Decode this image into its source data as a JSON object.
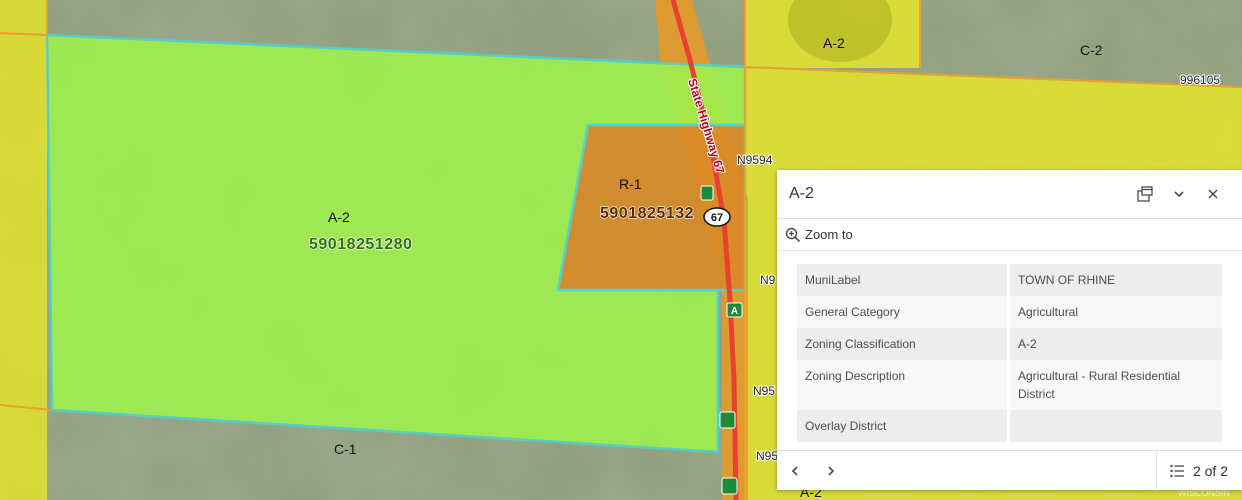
{
  "map": {
    "zone_labels": [
      "A-2",
      "C-2",
      "R-1",
      "A-2",
      "C-1",
      "A-2"
    ],
    "parcel_numbers": [
      "59018251280",
      "5901825132"
    ],
    "partial_parcel_number": "996105",
    "highway_name": "State Highway 67",
    "highway_shield": "67",
    "road_labels": [
      "N9594",
      "N9",
      "N95",
      "N95"
    ],
    "road_markers": [
      "A"
    ],
    "watermark": "WISCONSIN",
    "colors": {
      "agricultural": "#9ff04e",
      "residential": "#d98a28",
      "yellow_zone": "#e6e622",
      "outline": "#4fd3d0",
      "highway": "#e8412f"
    }
  },
  "popup": {
    "title": "A-2",
    "icons": {
      "dock": "dock-icon",
      "collapse": "chevron-down-icon",
      "close": "close-icon",
      "zoom": "zoom-in-icon"
    },
    "zoom_label": "Zoom to",
    "attributes": [
      {
        "key": "MuniLabel",
        "value": "TOWN OF RHINE"
      },
      {
        "key": "General Category",
        "value": "Agricultural"
      },
      {
        "key": "Zoning Classification",
        "value": "A-2"
      },
      {
        "key": "Zoning Description",
        "value": "Agricultural - Rural Residential District"
      },
      {
        "key": "Overlay District",
        "value": ""
      }
    ],
    "feature_count": "2 of 2"
  }
}
